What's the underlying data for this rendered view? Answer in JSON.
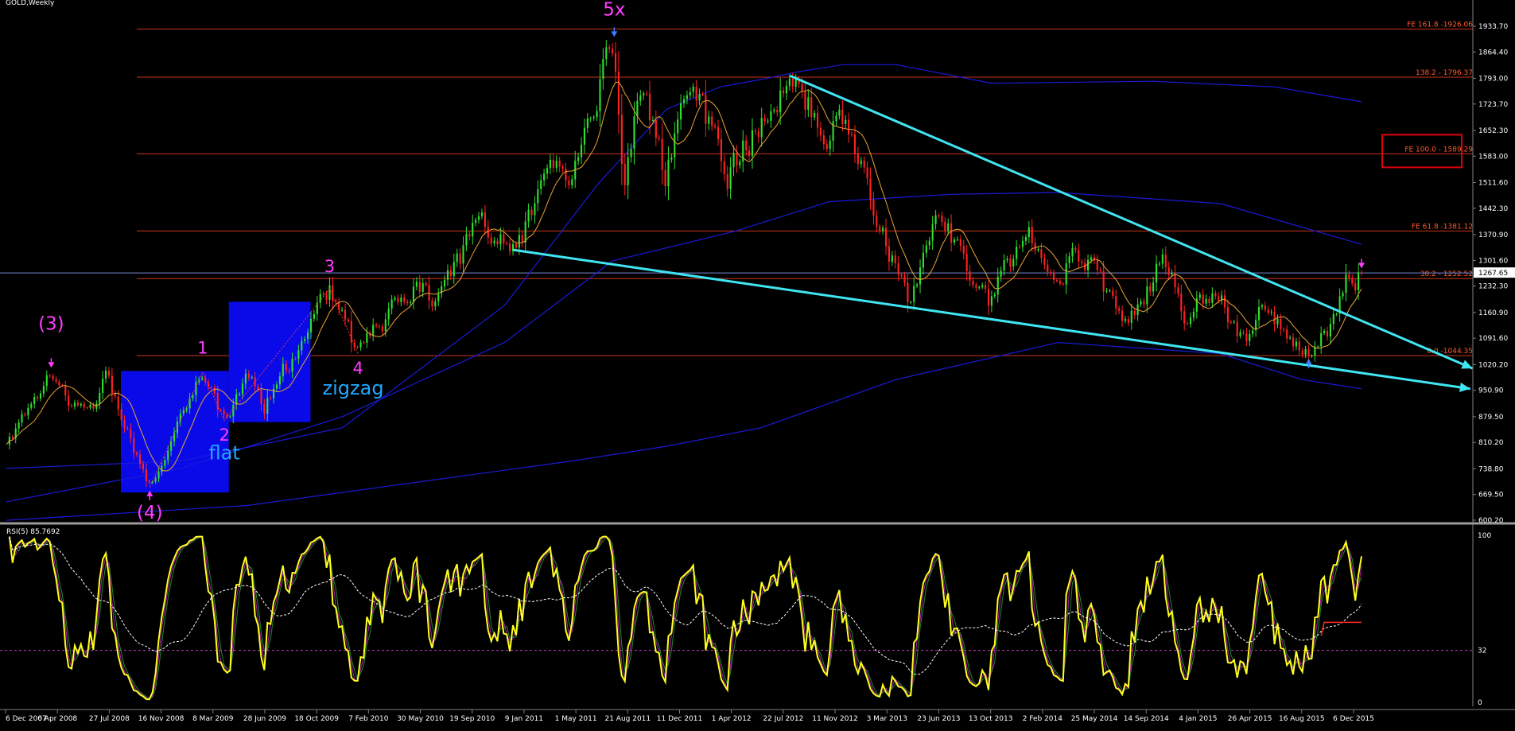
{
  "window": {
    "symbol_label": "GOLD,Weekly"
  },
  "chart_data": [
    {
      "type": "candlestick",
      "title": "GOLD,Weekly",
      "ylim": [
        600.2,
        1933.7
      ],
      "price_axis_ticks": [
        "1933.70",
        "1864.40",
        "1793.00",
        "1723.70",
        "1652.30",
        "1583.00",
        "1511.60",
        "1442.30",
        "1370.90",
        "1301.60",
        "1232.30",
        "1160.90",
        "1091.60",
        "1020.20",
        "950.90",
        "879.50",
        "810.20",
        "738.80",
        "669.50",
        "600.20"
      ],
      "current_price_label": "1267.65",
      "date_axis_labels": [
        "6 Dec 2007",
        "6 Apr 2008",
        "27 Jul 2008",
        "16 Nov 2008",
        "8 Mar 2009",
        "28 Jun 2009",
        "18 Oct 2009",
        "7 Feb 2010",
        "30 May 2010",
        "19 Sep 2010",
        "9 Jan 2011",
        "1 May 2011",
        "21 Aug 2011",
        "11 Dec 2011",
        "1 Apr 2012",
        "22 Jul 2012",
        "11 Nov 2012",
        "3 Mar 2013",
        "23 Jun 2013",
        "13 Oct 2013",
        "2 Feb 2014",
        "25 May 2014",
        "14 Sep 2014",
        "4 Jan 2015",
        "26 Apr 2015",
        "16 Aug 2015",
        "6 Dec 2015"
      ],
      "price_path": [
        [
          "2007-12-06",
          800
        ],
        [
          "2008-03-16",
          1005
        ],
        [
          "2008-04-20",
          930
        ],
        [
          "2008-06-20",
          930
        ],
        [
          "2008-07-15",
          990
        ],
        [
          "2008-10-24",
          690
        ],
        [
          "2009-02-20",
          1000
        ],
        [
          "2009-04-10",
          870
        ],
        [
          "2009-06-01",
          985
        ],
        [
          "2009-07-10",
          910
        ],
        [
          "2009-12-03",
          1225
        ],
        [
          "2010-02-05",
          1050
        ],
        [
          "2010-06-20",
          1255
        ],
        [
          "2010-07-25",
          1160
        ],
        [
          "2010-11-10",
          1420
        ],
        [
          "2011-01-25",
          1320
        ],
        [
          "2011-04-25",
          1575
        ],
        [
          "2011-05-25",
          1480
        ],
        [
          "2011-09-05",
          1920
        ],
        [
          "2011-09-26",
          1540
        ],
        [
          "2011-11-08",
          1800
        ],
        [
          "2011-12-29",
          1530
        ],
        [
          "2012-02-28",
          1790
        ],
        [
          "2012-05-16",
          1530
        ],
        [
          "2012-10-05",
          1795
        ],
        [
          "2012-12-28",
          1640
        ],
        [
          "2013-02-05",
          1690
        ],
        [
          "2013-06-28",
          1180
        ],
        [
          "2013-08-28",
          1430
        ],
        [
          "2013-12-31",
          1190
        ],
        [
          "2014-03-17",
          1390
        ],
        [
          "2014-06-02",
          1240
        ],
        [
          "2014-07-10",
          1345
        ],
        [
          "2014-11-07",
          1130
        ],
        [
          "2015-01-22",
          1305
        ],
        [
          "2015-03-17",
          1145
        ],
        [
          "2015-05-18",
          1232
        ],
        [
          "2015-07-24",
          1080
        ],
        [
          "2015-08-24",
          1170
        ],
        [
          "2015-12-17",
          1050
        ],
        [
          "2016-01-29",
          1120
        ],
        [
          "2016-03-11",
          1260
        ],
        [
          "2016-03-25",
          1215
        ],
        [
          "2016-04-14",
          1267.65
        ]
      ],
      "moving_average": {
        "color": "#e8a435"
      },
      "bollinger_band": {
        "color": "#1a1ad8"
      },
      "fibonacci_levels": [
        {
          "label": "FE 161.8 -1926.06",
          "price": 1926.06
        },
        {
          "label": "138.2 - 1796.37",
          "price": 1796.37
        },
        {
          "label": "FE 100.0 - 1589.29",
          "price": 1589.29
        },
        {
          "label": "FE 61.8 -1381.12",
          "price": 1381.12
        },
        {
          "label": "38.2 - 1252.52",
          "price": 1252.52
        },
        {
          "label": "0.0 -1044.35",
          "price": 1044.35
        }
      ],
      "wave_labels": [
        {
          "text": "(3)",
          "date": "2008-03-16",
          "price": 1115,
          "color": "#ff3cff"
        },
        {
          "text": "(4)",
          "date": "2008-10-24",
          "price": 605,
          "color": "#ff3cff"
        },
        {
          "text": "1",
          "date": "2009-02-20",
          "price": 1050,
          "color": "#ff3cff"
        },
        {
          "text": "2",
          "date": "2009-04-10",
          "price": 815,
          "color": "#ff3cff"
        },
        {
          "text": "flat",
          "date": "2009-04-10",
          "price": 765,
          "color": "#21a8ff"
        },
        {
          "text": "3",
          "date": "2009-12-03",
          "price": 1270,
          "color": "#ff3cff"
        },
        {
          "text": "4",
          "date": "2010-02-05",
          "price": 995,
          "color": "#ff3cff"
        },
        {
          "text": "zigzag",
          "date": "2010-01-25",
          "price": 940,
          "color": "#21a8ff"
        },
        {
          "text": "5x",
          "date": "2011-09-05",
          "price": 1963,
          "color": "#ff3cff"
        }
      ],
      "trendlines": [
        {
          "from": [
            "2012-10-05",
            1800
          ],
          "to": [
            "2016-12-20",
            1010
          ],
          "color": "#3fe6f2"
        },
        {
          "from": [
            "2011-01-20",
            1330
          ],
          "to": [
            "2016-12-15",
            955
          ],
          "color": "#3fe6f2"
        }
      ],
      "target_box_color": "#e0000e"
    },
    {
      "type": "line",
      "title": "RSI(5) 85.7692",
      "ylim": [
        0,
        100
      ],
      "reference_level": 32,
      "y_axis_labels": [
        "100",
        "32",
        "0"
      ],
      "main_line_color": "#ffff1e",
      "signal_line_color": "#ffffff",
      "last_value": 85.7692
    }
  ]
}
